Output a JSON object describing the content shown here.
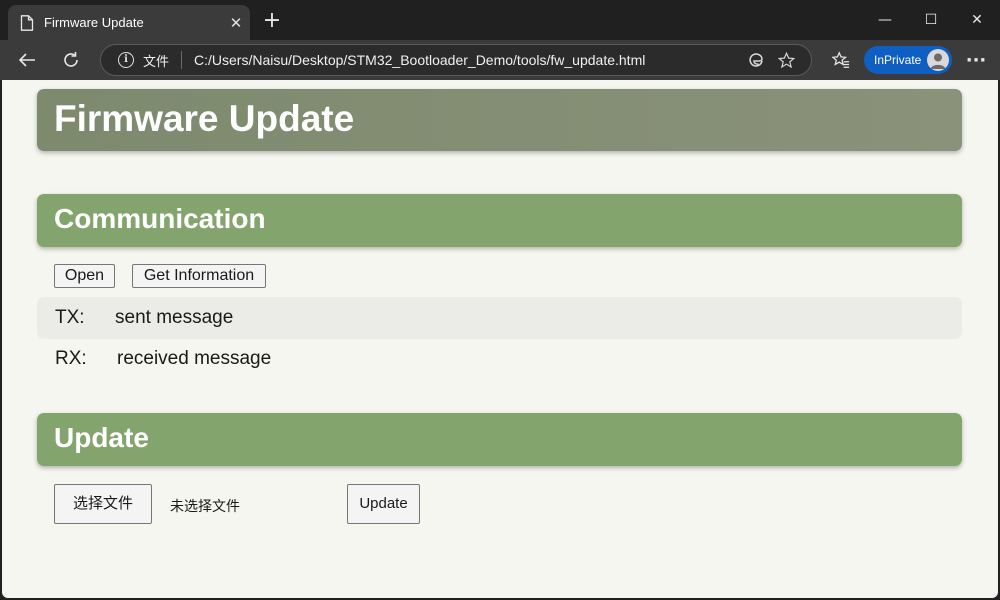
{
  "browser": {
    "tab_title": "Firmware Update",
    "tab_close": "✕",
    "new_tab": "+",
    "file_label": "文件",
    "url": "C:/Users/Naisu/Desktop/STM32_Bootloader_Demo/tools/fw_update.html",
    "inprivate_label": "InPrivate",
    "window_controls": {
      "minimize": "—",
      "maximize": "☐",
      "close": "✕"
    },
    "more_menu": "···"
  },
  "page": {
    "title": "Firmware Update",
    "communication": {
      "heading": "Communication",
      "open_button": "Open",
      "get_info_button": "Get Information",
      "tx_label": "TX:",
      "tx_value": "sent message",
      "rx_label": "RX:",
      "rx_value": "received message"
    },
    "update": {
      "heading": "Update",
      "choose_file_button": "选择文件",
      "no_file_text": "未选择文件",
      "update_button": "Update"
    }
  },
  "colors": {
    "header_panel": "#848e76",
    "section_panel": "#84a46d",
    "page_background": "#f4f6ef",
    "inprivate_badge": "#0f5ec2"
  },
  "icons": [
    "document-icon",
    "back-icon",
    "refresh-icon",
    "info-icon",
    "edge-icon",
    "star-icon",
    "favorites-icon",
    "avatar-icon"
  ]
}
